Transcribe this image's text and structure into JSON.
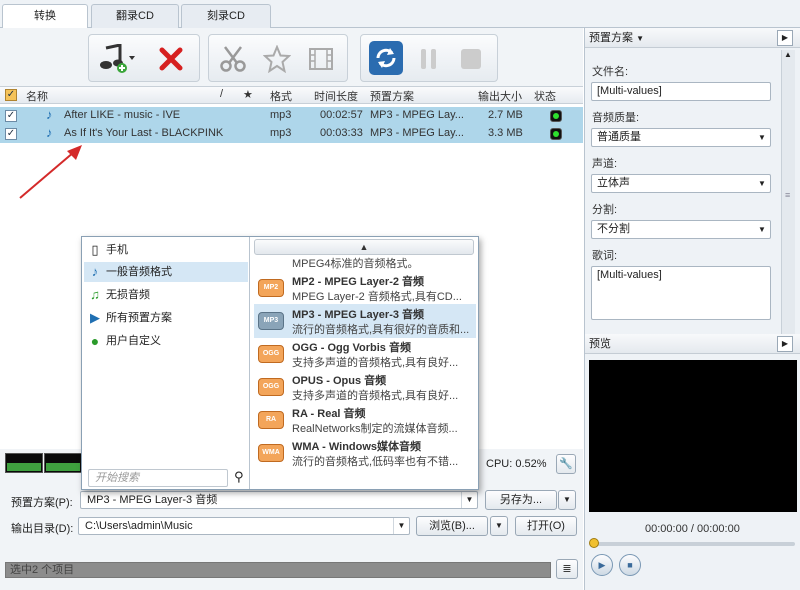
{
  "tabs": [
    {
      "label": "转换",
      "active": true
    },
    {
      "label": "翻录CD",
      "active": false
    },
    {
      "label": "刻录CD",
      "active": false
    }
  ],
  "toolbar": {
    "add_music_icon": "music-add-icon",
    "remove_icon": "red-x-icon",
    "cut_icon": "scissors-icon",
    "effects_icon": "star-icon",
    "video_icon": "film-icon",
    "convert_icon": "convert-cycle-icon",
    "pause_icon": "pause-icon",
    "stop_icon": "stop-icon"
  },
  "columns": {
    "name": "名称",
    "sep": "/",
    "star": "★",
    "format": "格式",
    "duration": "时间长度",
    "preset": "预置方案",
    "output_size": "输出大小",
    "status": "状态"
  },
  "files": [
    {
      "name": "After LIKE - music - IVE",
      "format": "mp3",
      "duration": "00:02:57",
      "preset": "MP3 - MPEG Lay...",
      "size": "2.7 MB"
    },
    {
      "name": "As If It's Your Last - BLACKPINK",
      "format": "mp3",
      "duration": "00:03:33",
      "preset": "MP3 - MPEG Lay...",
      "size": "3.3 MB"
    }
  ],
  "popup": {
    "categories": [
      {
        "label": "手机",
        "icon": "phone-icon"
      },
      {
        "label": "一般音频格式",
        "icon": "music-note-icon"
      },
      {
        "label": "无损音频",
        "icon": "music-note-icon"
      },
      {
        "label": "所有预置方案",
        "icon": "play-icon"
      },
      {
        "label": "用户自定义",
        "icon": "green-dot-icon"
      }
    ],
    "search_placeholder": "开始搜索",
    "scroll_up": "▲",
    "formats": [
      {
        "name": "",
        "desc": "MPEG4标准的音频格式。",
        "badge": "MP4"
      },
      {
        "name": "MP2 - MPEG Layer-2 音频",
        "desc": "MPEG Layer-2 音频格式,具有CD...",
        "badge": "MP2"
      },
      {
        "name": "MP3 - MPEG Layer-3 音频",
        "desc": "流行的音频格式,具有很好的音质和...",
        "badge": "MP3"
      },
      {
        "name": "OGG - Ogg Vorbis 音频",
        "desc": "支持多声道的音频格式,具有良好...",
        "badge": "OGG"
      },
      {
        "name": "OPUS - Opus 音频",
        "desc": "支持多声道的音频格式,具有良好...",
        "badge": "OGG"
      },
      {
        "name": "RA - Real 音频",
        "desc": "RealNetworks制定的流媒体音频...",
        "badge": "RA"
      },
      {
        "name": "WMA - Windows媒体音频",
        "desc": "流行的音频格式,低码率也有不错...",
        "badge": "WMA"
      }
    ]
  },
  "cpu": "CPU: 0.52%",
  "preset_row": {
    "label": "预置方案(P):",
    "value": "MP3 - MPEG Layer-3 音频",
    "save_as": "另存为..."
  },
  "output_row": {
    "label": "输出目录(D):",
    "value": "C:\\Users\\admin\\Music",
    "browse": "浏览(B)...",
    "open": "打开(O)"
  },
  "statusbar": "选中2 个项目",
  "right_panel": {
    "title": "预置方案",
    "filename_label": "文件名:",
    "filename_value": "[Multi-values]",
    "quality_label": "音频质量:",
    "quality_value": "普通质量",
    "channel_label": "声道:",
    "channel_value": "立体声",
    "split_label": "分割:",
    "split_value": "不分割",
    "lyrics_label": "歌词:",
    "lyrics_value": "[Multi-values]",
    "preview_title": "预览",
    "timecode": "00:00:00 / 00:00:00"
  }
}
